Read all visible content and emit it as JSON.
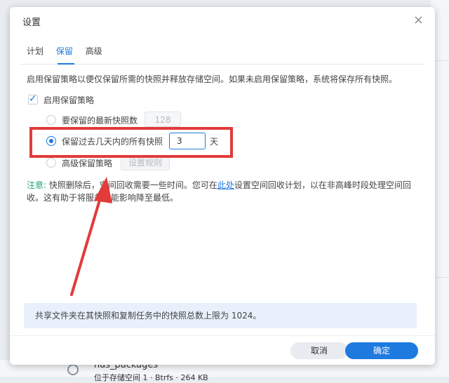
{
  "background": {
    "package_name": "nas_packages",
    "volume_text": "位于存储空间 1 · Btrfs · 264 KB"
  },
  "dialog": {
    "title": "设置",
    "tabs": [
      {
        "label": "计划"
      },
      {
        "label": "保留",
        "active": true
      },
      {
        "label": "高级"
      }
    ],
    "description": "启用保留策略以便仅保留所需的快照并释放存储空间。如果未启用保留策略，系统将保存所有快照。",
    "enable_policy": {
      "label": "启用保留策略",
      "checked": true
    },
    "option_latest": {
      "label": "要保留的最新快照数",
      "value": "128"
    },
    "option_days": {
      "label": "保留过去几天内的所有快照",
      "value": "3",
      "unit": "天",
      "selected": true
    },
    "option_advanced": {
      "label": "高级保留策略",
      "button": "设置规则"
    },
    "note": {
      "label": "注意:",
      "text_before": " 快照删除后，空间回收需要一些时间。您可在",
      "link": "此处",
      "text_after": "设置空间回收计划，以在非高峰时段处理空间回收。这有助于将服务性能影响降至最低。"
    },
    "info": "共享文件夹在其快照和复制任务中的快照总数上限为 1024。",
    "buttons": {
      "cancel": "取消",
      "ok": "确定"
    }
  },
  "colors": {
    "accent": "#1f7ae0",
    "annotation": "#e23b3b",
    "note_label": "#2aa57a"
  }
}
